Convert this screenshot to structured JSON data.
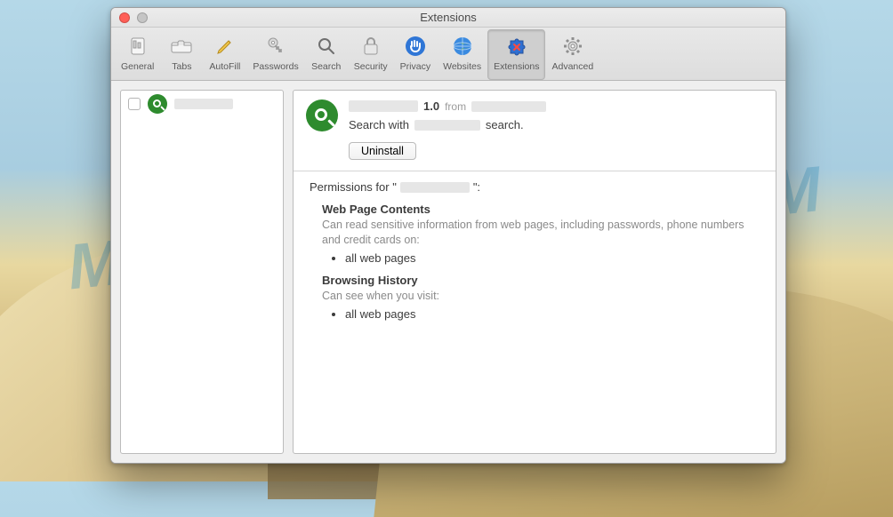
{
  "window": {
    "title": "Extensions"
  },
  "toolbar": {
    "items": [
      {
        "label": "General",
        "icon": "slider-icon"
      },
      {
        "label": "Tabs",
        "icon": "tabs-icon"
      },
      {
        "label": "AutoFill",
        "icon": "pencil-icon"
      },
      {
        "label": "Passwords",
        "icon": "key-icon"
      },
      {
        "label": "Search",
        "icon": "magnifier-icon"
      },
      {
        "label": "Security",
        "icon": "lock-icon"
      },
      {
        "label": "Privacy",
        "icon": "hand-icon"
      },
      {
        "label": "Websites",
        "icon": "globe-icon"
      },
      {
        "label": "Extensions",
        "icon": "puzzle-icon",
        "selected": true
      },
      {
        "label": "Advanced",
        "icon": "gear-icon"
      }
    ]
  },
  "sidebar": {
    "items": [
      {
        "checked": false,
        "icon": "search-ext-icon",
        "name_redacted": true
      }
    ]
  },
  "detail": {
    "name_redacted": true,
    "version": "1.0",
    "from_label": "from",
    "publisher_redacted": true,
    "desc_prefix": "Search with",
    "desc_mid_redacted": true,
    "desc_suffix": "search.",
    "uninstall_label": "Uninstall"
  },
  "permissions": {
    "title_prefix": "Permissions for \"",
    "title_name_redacted": true,
    "title_suffix": "\":",
    "sections": [
      {
        "heading": "Web Page Contents",
        "desc": "Can read sensitive information from web pages, including passwords, phone numbers and credit cards on:",
        "items": [
          "all web pages"
        ]
      },
      {
        "heading": "Browsing History",
        "desc": "Can see when you visit:",
        "items": [
          "all web pages"
        ]
      }
    ]
  },
  "watermark": "MYANTISPYWARE.COM"
}
